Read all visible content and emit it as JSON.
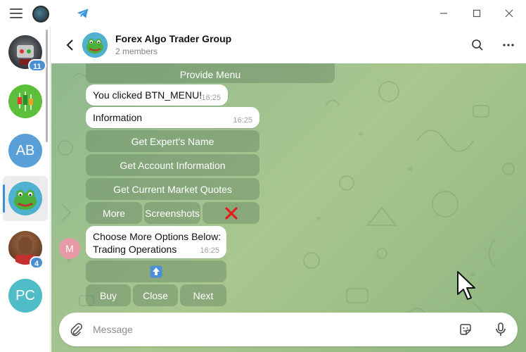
{
  "sidebar": {
    "chats": [
      {
        "initials": "",
        "badge": "11",
        "color": "#6b6b6b"
      },
      {
        "initials": "",
        "badge": "",
        "color": "#4caf3a"
      },
      {
        "initials": "AB",
        "badge": "",
        "color": "#5a9fd8"
      },
      {
        "initials": "",
        "badge": "",
        "color": "#4fb0d0",
        "active": true
      },
      {
        "initials": "",
        "badge": "4",
        "color": "#8b5a3c"
      },
      {
        "initials": "PC",
        "badge": "",
        "color": "#4fbcc8"
      }
    ]
  },
  "header": {
    "title": "Forex Algo Trader Group",
    "subtitle": "2 members"
  },
  "messages": {
    "top_button": "Provide Menu",
    "m1": {
      "text": "You clicked BTN_MENU!",
      "time": "16:25"
    },
    "m2": {
      "text": "Information",
      "time": "16:25"
    },
    "kbd1": {
      "b1": "Get Expert's Name",
      "b2": "Get Account Information",
      "b3": "Get Current Market Quotes",
      "b4": "More",
      "b5": "Screenshots",
      "b6": "❌"
    },
    "sender_initial": "M",
    "m3": {
      "line1": "Choose More Options Below:",
      "line2": "Trading Operations",
      "time": "16:25"
    },
    "kbd2": {
      "up": "⬆️",
      "buy": "Buy",
      "close": "Close",
      "next": "Next"
    }
  },
  "input": {
    "placeholder": "Message"
  },
  "colors": {
    "accent": "#3a90d6",
    "chat_bg": "#9fc28c",
    "badge": "#4a8fd2"
  },
  "icons": [
    "menu-icon",
    "telegram-icon",
    "minimize-icon",
    "maximize-icon",
    "close-icon",
    "back-arrow-icon",
    "search-icon",
    "more-icon",
    "attach-icon",
    "sticker-icon",
    "mic-icon",
    "up-arrow-icon",
    "cross-mark-icon"
  ]
}
